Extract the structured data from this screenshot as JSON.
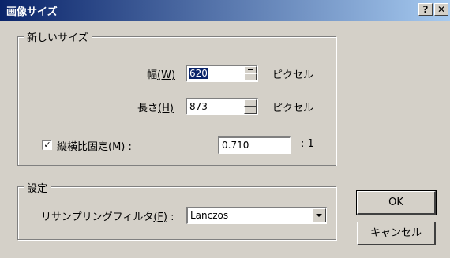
{
  "window": {
    "title": "画像サイズ",
    "help_glyph": "?",
    "close_glyph": "✕"
  },
  "new_size": {
    "group_label": "新しいサイズ",
    "width_label": "幅",
    "width_mnemonic": "(W)",
    "width_value": "620",
    "height_label": "長さ",
    "height_mnemonic": "(H)",
    "height_value": "873",
    "unit": "ピクセル",
    "aspect_checked": true,
    "aspect_label": "縦横比固定",
    "aspect_mnemonic": "(M)",
    "aspect_colon": ":",
    "aspect_value": "0.710",
    "aspect_suffix": ": 1"
  },
  "settings": {
    "group_label": "設定",
    "filter_label": "リサンプリングフィルタ",
    "filter_mnemonic": "(F)",
    "filter_colon": ":",
    "filter_value": "Lanczos"
  },
  "buttons": {
    "ok": "OK",
    "cancel": "キャンセル"
  }
}
